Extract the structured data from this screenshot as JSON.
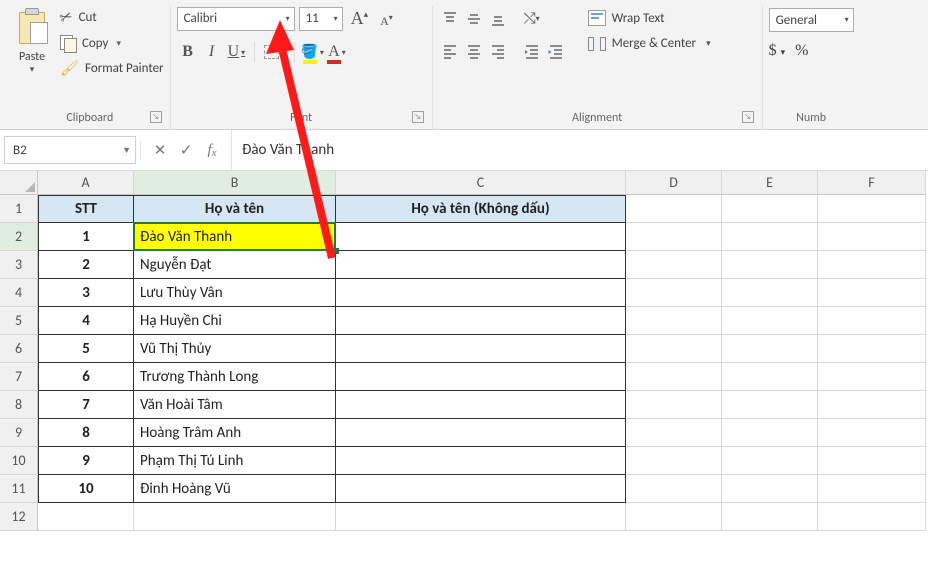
{
  "ribbon": {
    "clipboard": {
      "paste": "Paste",
      "cut": "Cut",
      "copy": "Copy",
      "format_painter": "Format Painter",
      "group_label": "Clipboard"
    },
    "font": {
      "font_name": "Calibri",
      "font_size": "11",
      "group_label": "Font"
    },
    "alignment": {
      "wrap_text": "Wrap Text",
      "merge_center": "Merge & Center",
      "group_label": "Alignment"
    },
    "number": {
      "format": "General",
      "currency": "$",
      "percent": "%",
      "group_label": "Numb"
    }
  },
  "namebox": "B2",
  "formula_value": "Đào Văn Thanh",
  "columns": [
    "A",
    "B",
    "C",
    "D",
    "E",
    "F"
  ],
  "active_column": "B",
  "active_row": "2",
  "row_count": 12,
  "table": {
    "headers": {
      "stt": "STT",
      "name": "Họ và tên",
      "name_noaccent": "Họ và tên (Không dấu)"
    },
    "rows": [
      {
        "stt": "1",
        "name": "Đào Văn Thanh"
      },
      {
        "stt": "2",
        "name": "Nguyễn Đạt"
      },
      {
        "stt": "3",
        "name": "Lưu Thùy Vân"
      },
      {
        "stt": "4",
        "name": "Hạ Huyền Chi"
      },
      {
        "stt": "5",
        "name": "Vũ Thị Thủy"
      },
      {
        "stt": "6",
        "name": "Trương Thành Long"
      },
      {
        "stt": "7",
        "name": "Văn Hoài Tâm"
      },
      {
        "stt": "8",
        "name": "Hoàng Trâm Anh"
      },
      {
        "stt": "9",
        "name": "Phạm Thị Tú Linh"
      },
      {
        "stt": "10",
        "name": "Đinh Hoàng Vũ"
      }
    ]
  }
}
